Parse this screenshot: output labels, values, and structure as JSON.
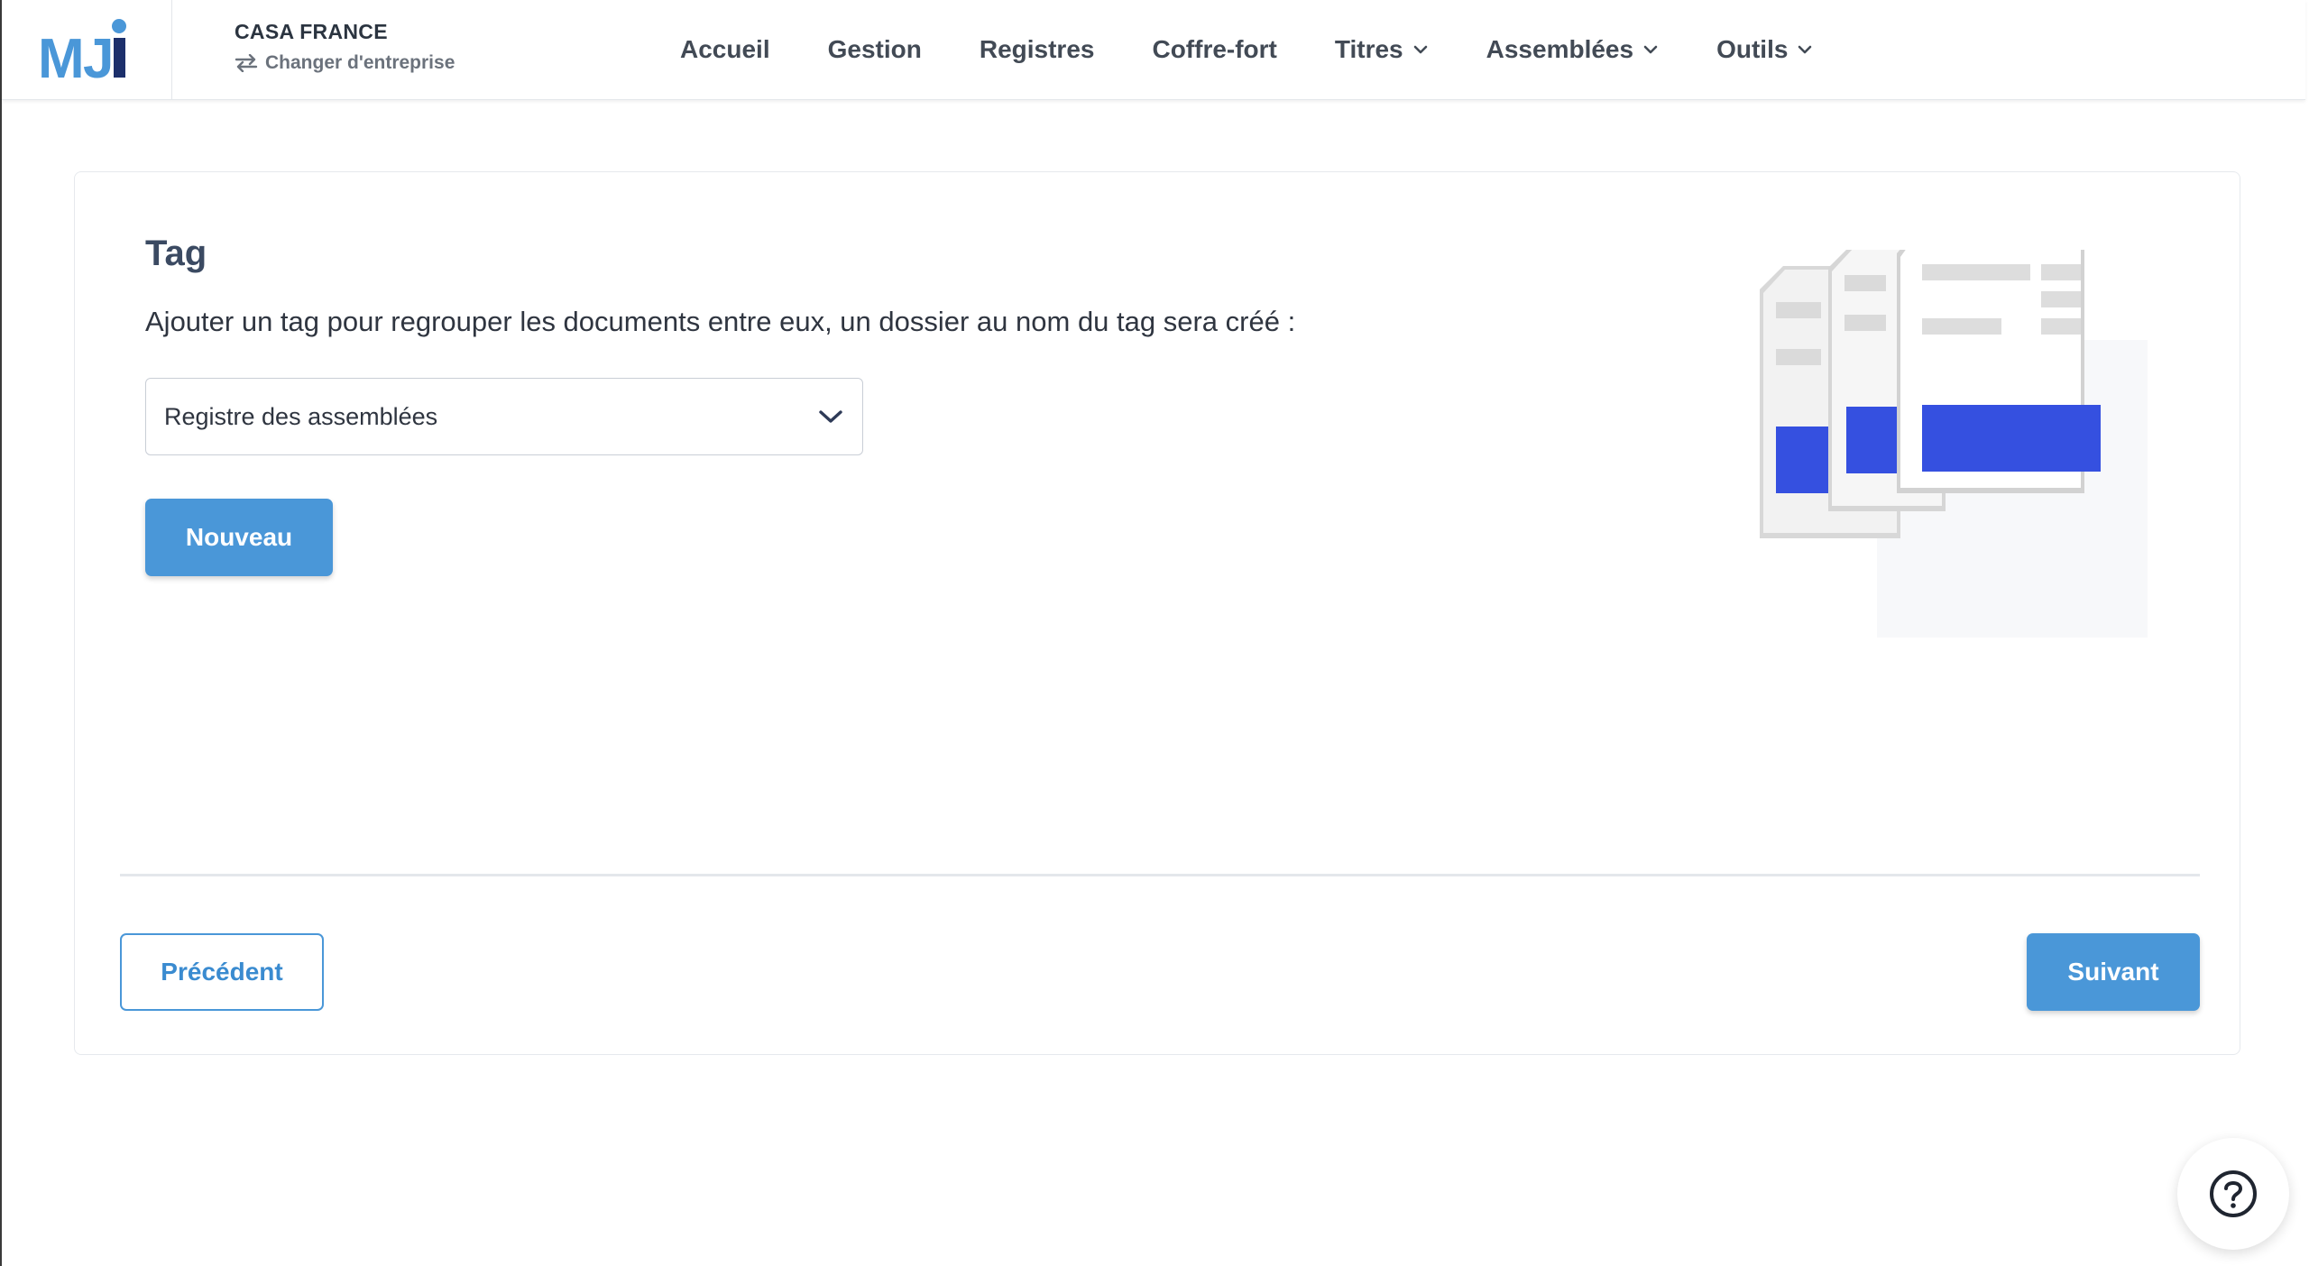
{
  "header": {
    "logo_text": "MJi",
    "company_name": "CASA FRANCE",
    "switch_company_label": "Changer d'entreprise",
    "nav": [
      {
        "label": "Accueil",
        "icon": null
      },
      {
        "label": "Gestion",
        "icon": null
      },
      {
        "label": "Registres",
        "icon": null
      },
      {
        "label": "Coffre-fort",
        "icon": null
      },
      {
        "label": "Titres",
        "icon": "chevron-down-icon"
      },
      {
        "label": "Assemblées",
        "icon": "chevron-down-icon"
      },
      {
        "label": "Outils",
        "icon": "chevron-down-icon"
      }
    ]
  },
  "main": {
    "title": "Tag",
    "description": "Ajouter un tag pour regrouper les documents entre eux, un dossier au nom du tag sera créé :",
    "tag_select": {
      "selected": "Registre des assemblées"
    },
    "new_button_label": "Nouveau",
    "prev_button_label": "Précédent",
    "next_button_label": "Suivant"
  },
  "help_icon": "question-circle-icon",
  "colors": {
    "primary": "#4a97d8",
    "illustration_accent": "#3550e0",
    "logo_blue": "#4a97d8",
    "logo_dark": "#1c2f6b"
  }
}
